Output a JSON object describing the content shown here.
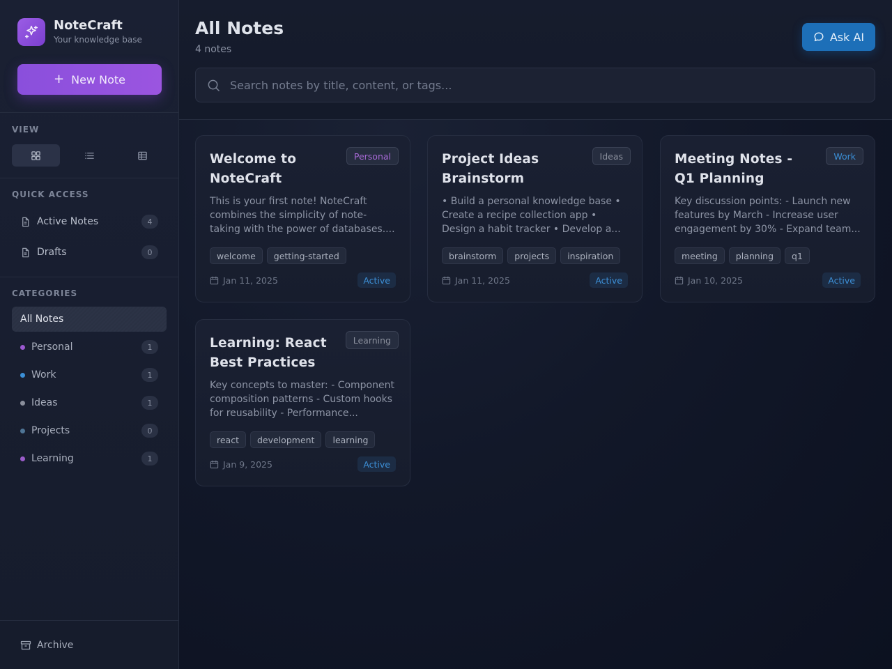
{
  "app": {
    "name": "NoteCraft",
    "subtitle": "Your knowledge base",
    "logo_icon": "sparkles-icon",
    "accent": "#8a4fdc"
  },
  "sidebar": {
    "new_note_label": "New Note",
    "view": {
      "title": "VIEW",
      "options": [
        {
          "name": "grid",
          "active": true
        },
        {
          "name": "list",
          "active": false
        },
        {
          "name": "table",
          "active": false
        }
      ]
    },
    "quick_access": {
      "title": "QUICK ACCESS",
      "items": [
        {
          "label": "Active Notes",
          "count": "4",
          "icon": "document-icon"
        },
        {
          "label": "Drafts",
          "count": "0",
          "icon": "document-icon"
        }
      ]
    },
    "categories": {
      "title": "CATEGORIES",
      "all_label": "All Notes",
      "items": [
        {
          "label": "Personal",
          "count": "1",
          "color": "#9b59d0"
        },
        {
          "label": "Work",
          "count": "1",
          "color": "#3b8fd6"
        },
        {
          "label": "Ideas",
          "count": "1",
          "color": "#8a8f9c"
        },
        {
          "label": "Projects",
          "count": "0",
          "color": "#4f7596"
        },
        {
          "label": "Learning",
          "count": "1",
          "color": "#9a5cc9"
        }
      ]
    },
    "archive_label": "Archive"
  },
  "header": {
    "title": "All Notes",
    "count": "4 notes",
    "ask_ai_label": "Ask AI",
    "search_placeholder": "Search notes by title, content, or tags..."
  },
  "notes": [
    {
      "title": "Welcome to NoteCraft",
      "category": "Personal",
      "category_color": "#a86ad6",
      "body": "This is your first note! NoteCraft combines the simplicity of note-taking with the power of databases....",
      "tags": [
        "welcome",
        "getting-started"
      ],
      "date": "Jan 11, 2025",
      "status": "Active"
    },
    {
      "title": "Project Ideas Brainstorm",
      "category": "Ideas",
      "category_color": "#8a8f9c",
      "body": "• Build a personal knowledge base • Create a recipe collection app • Design a habit tracker • Develop a...",
      "tags": [
        "brainstorm",
        "projects",
        "inspiration"
      ],
      "date": "Jan 11, 2025",
      "status": "Active"
    },
    {
      "title": "Meeting Notes - Q1 Planning",
      "category": "Work",
      "category_color": "#3b8fd6",
      "body": "Key discussion points: - Launch new features by March - Increase user engagement by 30% - Expand team...",
      "tags": [
        "meeting",
        "planning",
        "q1"
      ],
      "date": "Jan 10, 2025",
      "status": "Active"
    },
    {
      "title": "Learning: React Best Practices",
      "category": "Learning",
      "category_color": "#8a8f9c",
      "body": "Key concepts to master: - Component composition patterns - Custom hooks for reusability - Performance...",
      "tags": [
        "react",
        "development",
        "learning"
      ],
      "date": "Jan 9, 2025",
      "status": "Active"
    }
  ]
}
